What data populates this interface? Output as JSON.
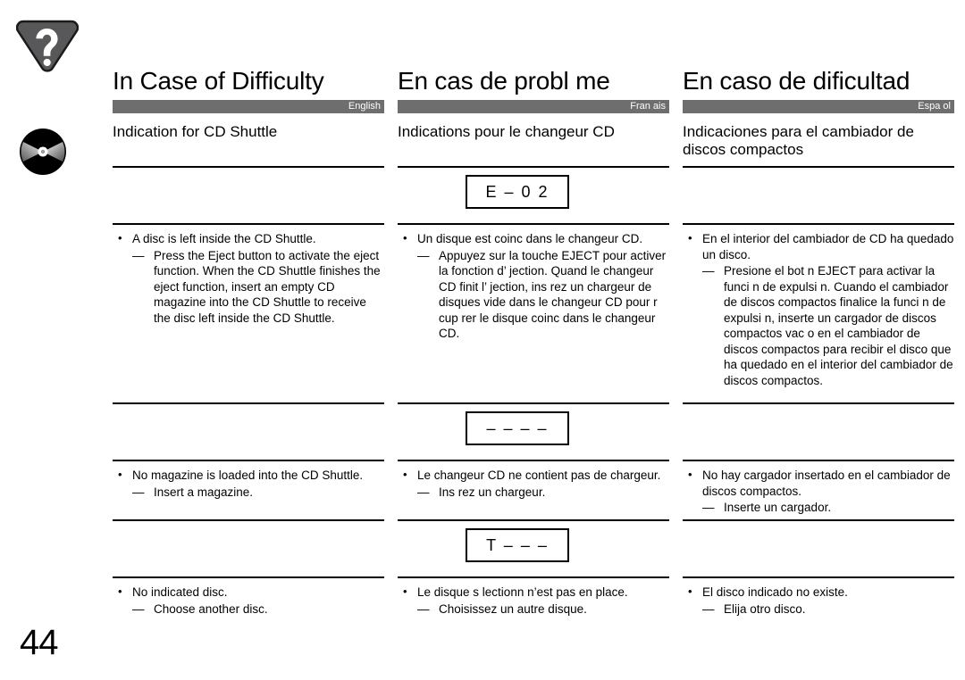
{
  "page": {
    "number": "44",
    "accent": "#6e6e6e"
  },
  "icons": {
    "help": "help-triangle-icon",
    "disc": "compact-disc-icon"
  },
  "columns": [
    {
      "id": "english",
      "title": "In Case of Difficulty",
      "language_label": "English",
      "subtitle": "Indication for CD Shuttle",
      "rows": [
        {
          "display": "",
          "bullet": "A disc is left inside the CD Shuttle.",
          "dash": "Press the Eject button to activate the eject function. When the CD Shuttle finishes the eject function, insert an empty CD magazine into the CD Shuttle to receive the disc left inside the CD Shuttle."
        },
        {
          "display": "",
          "bullet": "No magazine is loaded into the CD Shuttle.",
          "dash": "Insert a magazine."
        },
        {
          "display": "",
          "bullet": "No indicated disc.",
          "dash": "Choose another disc."
        }
      ]
    },
    {
      "id": "francais",
      "title": "En cas de probl me",
      "language_label": "Fran ais",
      "subtitle": "Indications pour le changeur CD",
      "rows": [
        {
          "display": "E – 0 2",
          "bullet": "Un disque est coinc  dans le changeur CD.",
          "dash": "Appuyez sur la touche EJECT pour activer la fonction d’ jection. Quand le changeur CD finit l’ jection, ins rez un chargeur de disques vide dans le changeur CD pour r cup rer le disque coinc  dans le changeur CD."
        },
        {
          "display": "– – – –",
          "bullet": "Le changeur CD ne contient pas de chargeur.",
          "dash": "Ins rez un chargeur."
        },
        {
          "display": "T – – –",
          "bullet": "Le disque s lectionn  n’est pas en place.",
          "dash": "Choisissez un autre disque."
        }
      ]
    },
    {
      "id": "espanol",
      "title": "En caso de dificultad",
      "language_label": "Espa ol",
      "subtitle": "Indicaciones para el cambiador de discos compactos",
      "rows": [
        {
          "display": "",
          "bullet": "En el interior del cambiador de CD ha quedado un disco.",
          "dash": "Presione el bot n EJECT para activar la funci n de expulsi n. Cuando el cambiador de discos compactos finalice la funci n de expulsi n, inserte un cargador de discos compactos vac o en el cambiador de discos compactos para recibir el disco que ha quedado en el interior del cambiador de discos compactos."
        },
        {
          "display": "",
          "bullet": "No hay cargador insertado en el cambiador de discos compactos.",
          "dash": "Inserte un cargador."
        },
        {
          "display": "",
          "bullet": "El disco indicado no existe.",
          "dash": "Elija otro disco."
        }
      ]
    }
  ]
}
